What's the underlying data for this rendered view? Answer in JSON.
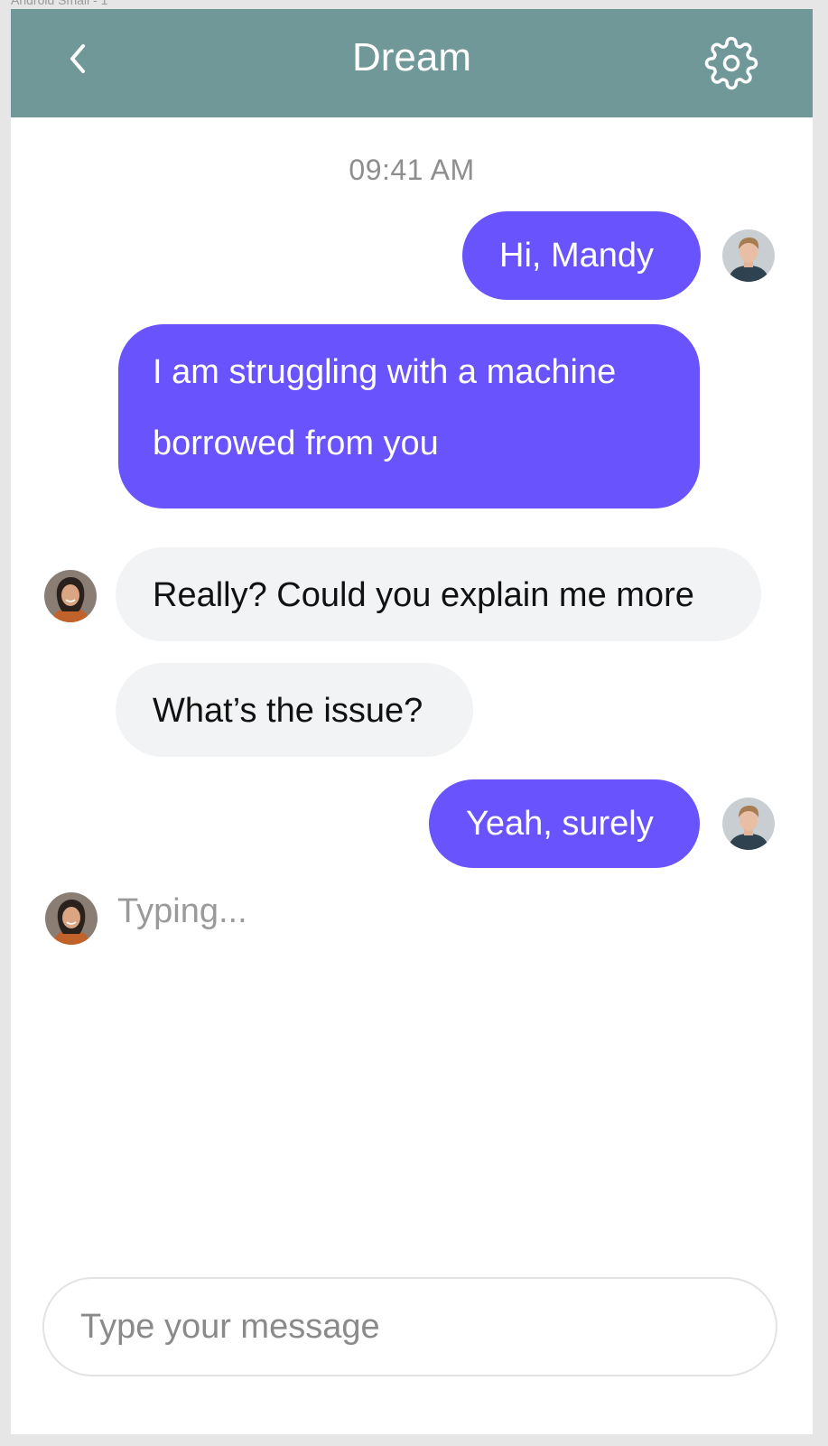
{
  "artboard_label": "Android Small - 1",
  "header": {
    "title": "Dream",
    "back_icon": "chevron-left-icon",
    "settings_icon": "gear-icon",
    "background_color": "#719898"
  },
  "chat": {
    "timestamp": "09:41 AM",
    "messages": [
      {
        "sender": "me",
        "text": "Hi, Mandy"
      },
      {
        "sender": "me",
        "line1": "I am struggling with a machine",
        "line2": "borrowed from you"
      },
      {
        "sender": "them",
        "text": "Really? Could you explain me more"
      },
      {
        "sender": "them",
        "text": "What’s the issue?"
      },
      {
        "sender": "me",
        "text": "Yeah, surely"
      }
    ],
    "typing_indicator": "Typing...",
    "outgoing_color": "#6853fd",
    "incoming_color": "#f2f3f4"
  },
  "composer": {
    "placeholder": "Type your message",
    "value": ""
  }
}
